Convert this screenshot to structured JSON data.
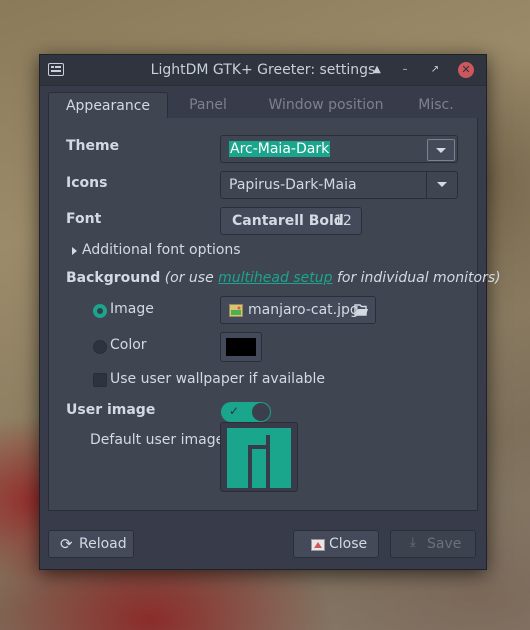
{
  "window": {
    "title": "LightDM GTK+ Greeter: settings"
  },
  "titlebar_buttons": {
    "shade_icon": "▲",
    "minimize_icon": "–",
    "maximize_icon": "↗",
    "close_icon": "✕"
  },
  "tabs": [
    {
      "label": "Appearance",
      "active": true
    },
    {
      "label": "Panel"
    },
    {
      "label": "Window position"
    },
    {
      "label": "Misc."
    }
  ],
  "appearance": {
    "theme": {
      "label": "Theme",
      "value": "Arc-Maia-Dark"
    },
    "icons": {
      "label": "Icons",
      "value": "Papirus-Dark-Maia"
    },
    "font": {
      "label": "Font",
      "name": "Cantarell Bold",
      "size": "12"
    },
    "additional_font_options": "Additional font options",
    "background": {
      "label": "Background",
      "note_pre": "(or use",
      "link": "multihead setup",
      "note_post": "for individual monitors)",
      "image_option": "Image",
      "image_file": "manjaro-cat.jpg",
      "color_option": "Color",
      "color_value": "#000000",
      "wallpaper_option": "Use user wallpaper if available",
      "selected": "Image",
      "use_user_wallpaper": false
    },
    "user_image": {
      "label": "User image",
      "enabled": true,
      "default_label": "Default user image"
    }
  },
  "footer": {
    "reload": "Reload",
    "close": "Close",
    "save": "Save"
  },
  "colors": {
    "accent": "#1aa58d",
    "window_bg": "#383c4a",
    "panel_bg": "#404552"
  }
}
